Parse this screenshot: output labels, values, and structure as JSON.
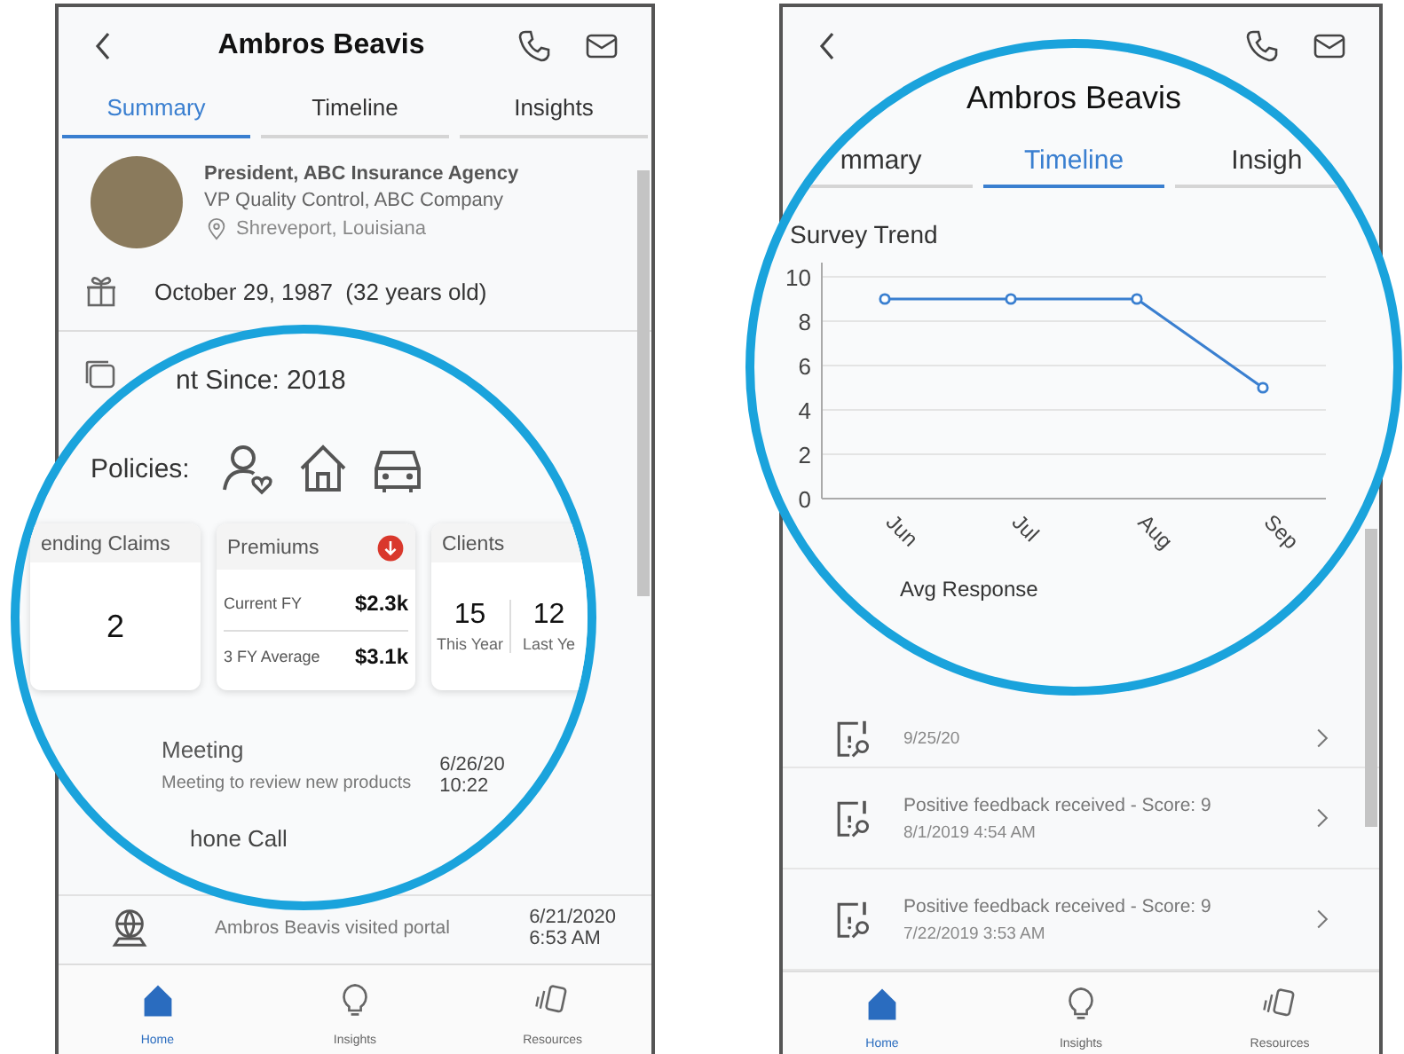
{
  "left_phone": {
    "title": "Ambros Beavis",
    "tabs": [
      {
        "label": "Summary",
        "selected": true
      },
      {
        "label": "Timeline",
        "selected": false
      },
      {
        "label": "Insights",
        "selected": false
      }
    ],
    "profile": {
      "headline": "President, ABC Insurance Agency",
      "role": "VP Quality Control, ABC Company",
      "location": "Shreveport, Louisiana"
    },
    "birthday": "October 29, 1987  (32 years old)",
    "activity": {
      "description": "Ambros Beavis visited portal",
      "date": "6/21/2020",
      "time": "6:53 AM"
    },
    "nav": [
      {
        "label": "Home",
        "selected": true
      },
      {
        "label": "Insights",
        "selected": false
      },
      {
        "label": "Resources",
        "selected": false
      }
    ]
  },
  "left_magnifier": {
    "account_since": "nt Since: 2018",
    "policies_label": "Policies:",
    "cards": [
      {
        "kind": "count",
        "title": "ending Claims",
        "value": "2"
      },
      {
        "kind": "pair",
        "title": "Premiums",
        "declining": true,
        "rows": [
          {
            "label": "Current FY",
            "value": "$2.3k"
          },
          {
            "label": "3 FY Average",
            "value": "$3.1k"
          }
        ]
      },
      {
        "kind": "split",
        "title": "Clients",
        "columns": [
          {
            "value": "15",
            "label": "This Year"
          },
          {
            "value": "12",
            "label": "Last Ye"
          }
        ]
      }
    ],
    "meeting": {
      "title": "Meeting",
      "description": "Meeting to review new products",
      "date": "6/26/20",
      "time": "10:22"
    },
    "next_title": "hone Call"
  },
  "right_magnifier": {
    "title": "Ambros Beavis",
    "tabs": [
      {
        "label": "mmary",
        "selected": false
      },
      {
        "label": "Timeline",
        "selected": true
      },
      {
        "label": "Insigh",
        "selected": false
      }
    ],
    "section_title": "Survey Trend",
    "chart_data": {
      "type": "line",
      "categories": [
        "Jun",
        "Jul",
        "Aug",
        "Sep"
      ],
      "series": [
        {
          "color": "#3a7fd0",
          "marker": true,
          "values": [
            9,
            9,
            9,
            5
          ]
        }
      ],
      "grid": true,
      "ylim": [
        0,
        10
      ],
      "yticks": [
        0,
        2,
        4,
        6,
        8,
        10
      ]
    },
    "list_header": "Avg Response"
  },
  "right_phone": {
    "feedback": [
      {
        "date": "9/25/20"
      },
      {
        "title": "Positive feedback received - Score: 9",
        "date": "8/1/2019 4:54 AM"
      },
      {
        "title": "Positive feedback received - Score: 9",
        "date": "7/22/2019 3:53 AM"
      }
    ],
    "nav": [
      {
        "label": "Home",
        "selected": true
      },
      {
        "label": "Insights",
        "selected": false
      },
      {
        "label": "Resources",
        "selected": false
      }
    ]
  }
}
